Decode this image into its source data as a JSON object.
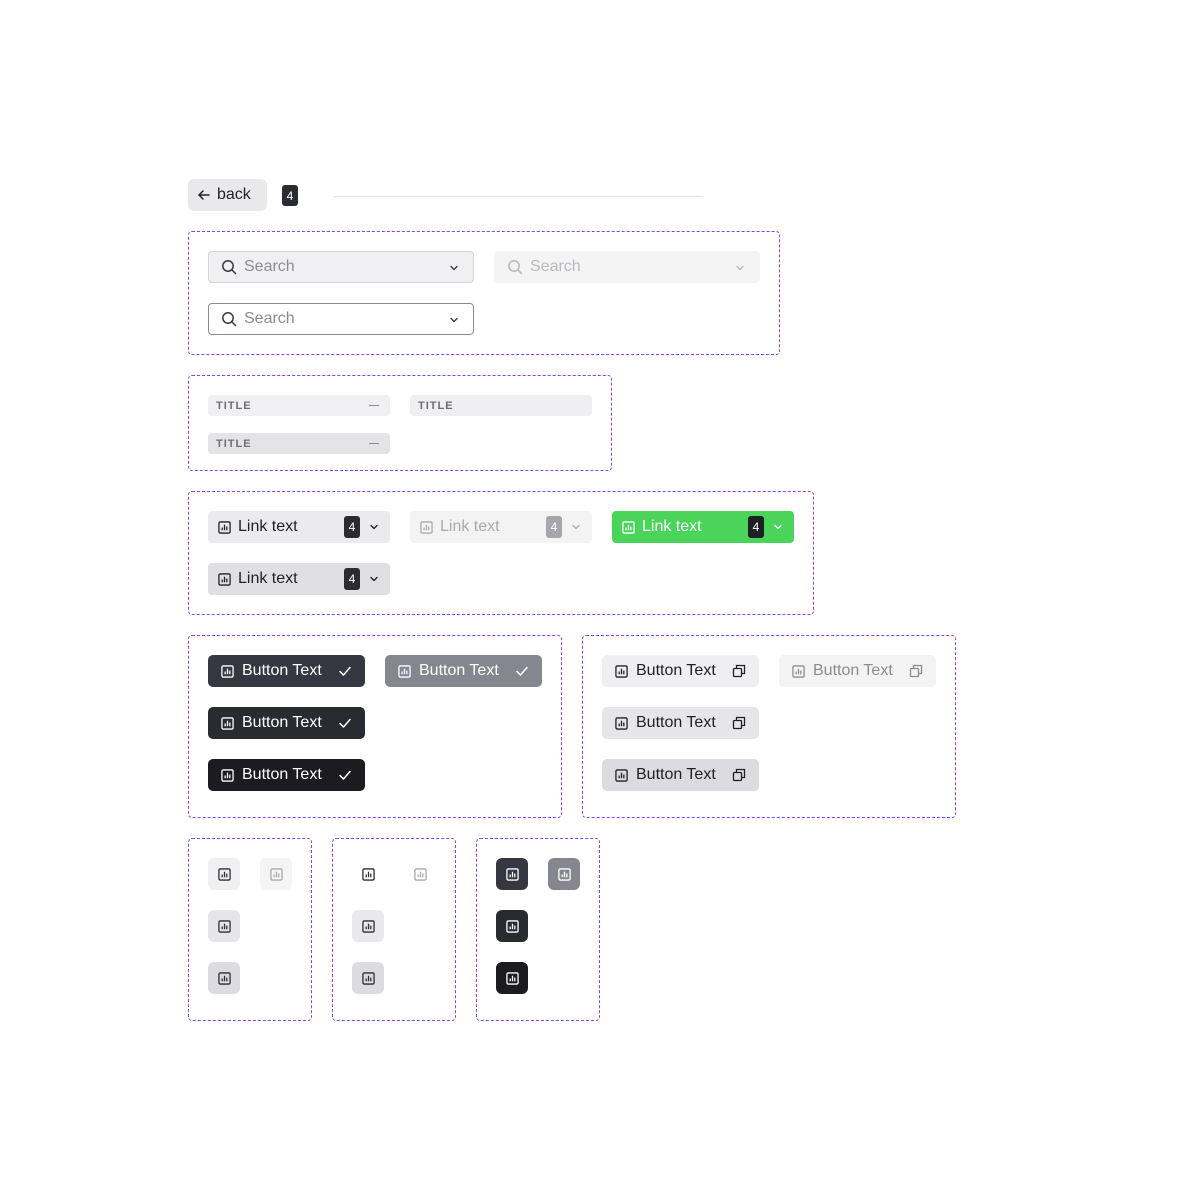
{
  "header": {
    "back_label": "back",
    "count": "4"
  },
  "search": {
    "placeholder": "Search"
  },
  "titles": {
    "label": "TITLE"
  },
  "links": {
    "label": "Link text",
    "count": "4"
  },
  "buttons": {
    "label": "Button Text"
  },
  "icons": {
    "chart": "bar-chart-icon",
    "check": "check-icon",
    "copy": "copy-icon",
    "chevron": "chevron-down-icon",
    "search": "search-icon",
    "back": "arrow-left-icon"
  },
  "colors": {
    "accent": "#8a3ffc",
    "success": "#4ad45a",
    "dark": "#2b2c33"
  }
}
